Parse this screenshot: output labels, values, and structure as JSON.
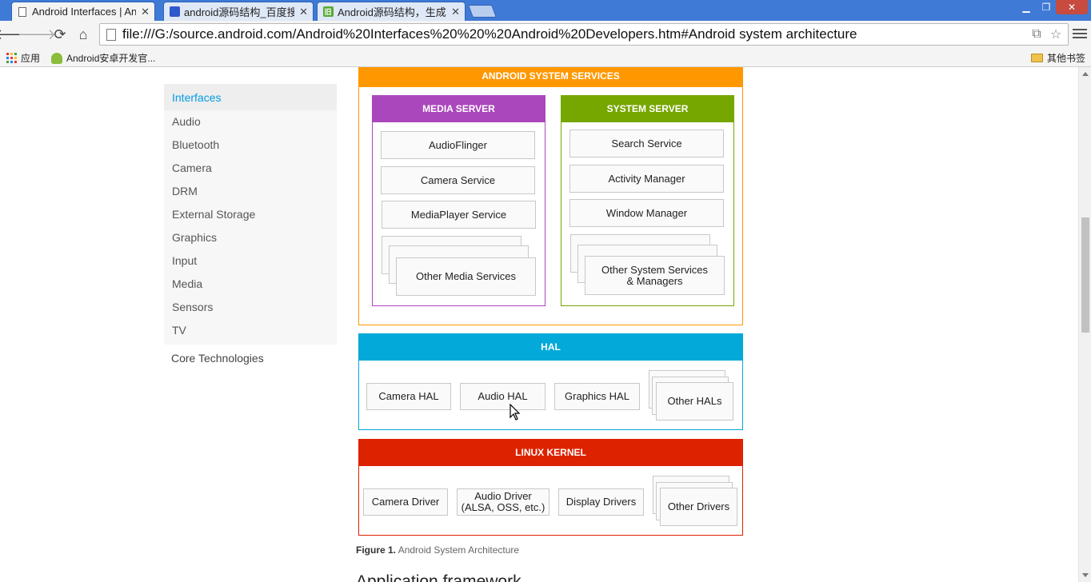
{
  "tabs": [
    {
      "title": "Android Interfaces | Anc",
      "active": true
    },
    {
      "title": "android源码结构_百度搜",
      "active": false
    },
    {
      "title": "Android源码结构，生成E",
      "active": false
    }
  ],
  "window_controls": {
    "minimize": "▁",
    "restore": "❐",
    "close": "✕"
  },
  "address_bar": {
    "url": "file:///G:/source.android.com/Android%20Interfaces%20%20%20Android%20Developers.htm#Android system architecture"
  },
  "bookmarks": {
    "apps": "应用",
    "android": "Android安卓开发官...",
    "other": "其他书签"
  },
  "sidenav": {
    "header": "Interfaces",
    "items": [
      "Audio",
      "Bluetooth",
      "Camera",
      "DRM",
      "External Storage",
      "Graphics",
      "Input",
      "Media",
      "Sensors",
      "TV"
    ],
    "core": "Core Technologies"
  },
  "diagram": {
    "system_services": {
      "title": "ANDROID SYSTEM SERVICES",
      "color": "#ff9800",
      "media_server": {
        "title": "MEDIA SERVER",
        "color": "#ab47bc",
        "items": [
          "AudioFlinger",
          "Camera Service",
          "MediaPlayer Service"
        ],
        "other": "Other Media Services"
      },
      "system_server": {
        "title": "SYSTEM SERVER",
        "color": "#76a600",
        "items": [
          "Search Service",
          "Activity Manager",
          "Window Manager"
        ],
        "other_line1": "Other System Services",
        "other_line2": "& Managers"
      }
    },
    "hal": {
      "title": "HAL",
      "color": "#03a9d8",
      "items": [
        "Camera HAL",
        "Audio HAL",
        "Graphics HAL"
      ],
      "other": "Other HALs"
    },
    "kernel": {
      "title": "LINUX KERNEL",
      "color": "#dd2200",
      "items": [
        "Camera Driver",
        "Display Drivers"
      ],
      "audio_line1": "Audio Driver",
      "audio_line2": "(ALSA, OSS, etc.)",
      "other": "Other Drivers"
    }
  },
  "caption": {
    "label": "Figure 1.",
    "text": "Android System Architecture"
  },
  "next_heading": "Application framework"
}
